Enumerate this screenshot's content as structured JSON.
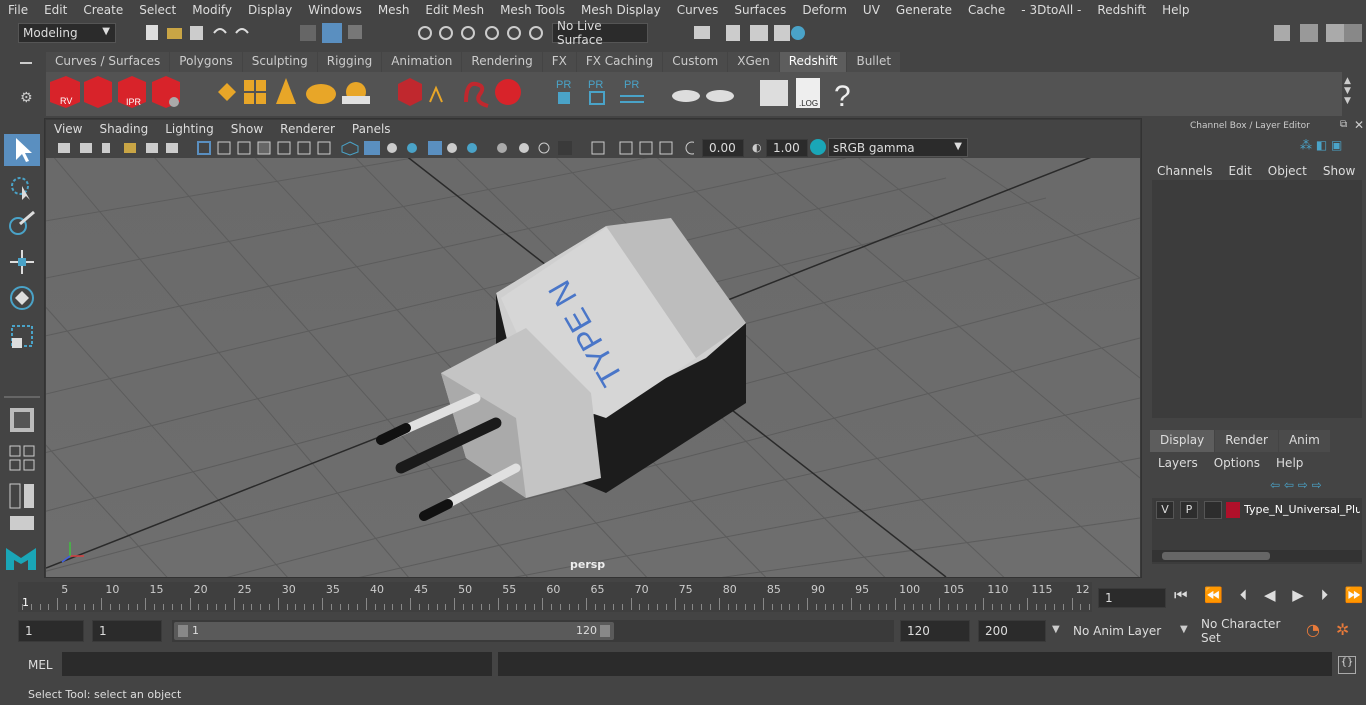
{
  "menus": [
    "File",
    "Edit",
    "Create",
    "Select",
    "Modify",
    "Display",
    "Windows",
    "Mesh",
    "Edit Mesh",
    "Mesh Tools",
    "Mesh Display",
    "Curves",
    "Surfaces",
    "Deform",
    "UV",
    "Generate",
    "Cache",
    "- 3DtoAll -",
    "Redshift",
    "Help"
  ],
  "status": {
    "mode": "Modeling",
    "live_surface": "No Live Surface"
  },
  "shelf_tabs": [
    "Curves / Surfaces",
    "Polygons",
    "Sculpting",
    "Rigging",
    "Animation",
    "Rendering",
    "FX",
    "FX Caching",
    "Custom",
    "XGen",
    "Redshift",
    "Bullet"
  ],
  "shelf_active": "Redshift",
  "shelf_icons": {
    "rv": "RV",
    "ipr": "IPR",
    "pr": "PR",
    "log": ".LOG",
    "help": "?"
  },
  "viewport": {
    "menus": [
      "View",
      "Shading",
      "Lighting",
      "Show",
      "Renderer",
      "Panels"
    ],
    "exposure": "0.00",
    "gamma": "1.00",
    "color_space": "sRGB gamma",
    "camera_label": "persp",
    "model_text": "TYPE N"
  },
  "channel_box": {
    "title": "Channel Box / Layer Editor",
    "menus": [
      "Channels",
      "Edit",
      "Object",
      "Show"
    ]
  },
  "layer_editor": {
    "tabs": [
      "Display",
      "Render",
      "Anim"
    ],
    "active_tab": "Display",
    "menus": [
      "Layers",
      "Options",
      "Help"
    ],
    "layer": {
      "v": "V",
      "p": "P",
      "name": "Type_N_Universal_Plug",
      "color": "#b0102a"
    }
  },
  "timeline": {
    "ticks": [
      "5",
      "10",
      "15",
      "20",
      "25",
      "30",
      "35",
      "40",
      "45",
      "50",
      "55",
      "60",
      "65",
      "70",
      "75",
      "80",
      "85",
      "90",
      "95",
      "100",
      "105",
      "110",
      "115",
      "12"
    ],
    "start_marker": "1",
    "current_frame": "1"
  },
  "range": {
    "start": "1",
    "playback_start": "1",
    "slider_start": "1",
    "slider_end": "120",
    "playback_end": "120",
    "end": "200",
    "anim_layer": "No Anim Layer",
    "character_set": "No Character Set"
  },
  "mel": {
    "label": "MEL"
  },
  "help_line": "Select Tool: select an object"
}
